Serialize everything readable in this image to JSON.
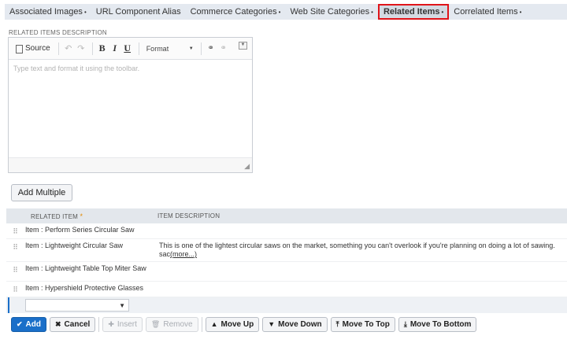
{
  "tabs": [
    {
      "label": "Associated Images",
      "caret": true,
      "active": false
    },
    {
      "label": "URL Component Alias",
      "caret": false,
      "active": false
    },
    {
      "label": "Commerce Categories",
      "caret": true,
      "active": false
    },
    {
      "label": "Web Site Categories",
      "caret": true,
      "active": false
    },
    {
      "label": "Related Items",
      "caret": true,
      "active": true
    },
    {
      "label": "Correlated Items",
      "caret": true,
      "active": false
    }
  ],
  "tab_caret": "•",
  "editor": {
    "section_label": "RELATED ITEMS DESCRIPTION",
    "source_label": "Source",
    "bold_label": "B",
    "italic_label": "I",
    "underline_label": "U",
    "format_label": "Format",
    "placeholder": "Type text and format it using the toolbar."
  },
  "add_multiple_label": "Add Multiple",
  "table": {
    "col_item": "RELATED ITEM",
    "col_item_required": "*",
    "col_desc": "ITEM DESCRIPTION",
    "rows": [
      {
        "item": "Item : Perform Series Circular Saw",
        "desc": "",
        "more": ""
      },
      {
        "item": "Item : Lightweight Circular Saw",
        "desc": "This is one of the lightest circular saws on the market, something you can't overlook if you're planning on doing a lot of sawing. sac",
        "more": "(more...)"
      },
      {
        "item": "Item : Lightweight Table Top Miter Saw",
        "desc": "",
        "more": ""
      },
      {
        "item": "Item : Hypershield Protective Glasses",
        "desc": "",
        "more": ""
      }
    ]
  },
  "actions": {
    "add": "Add",
    "cancel": "Cancel",
    "insert": "Insert",
    "remove": "Remove",
    "move_up": "Move Up",
    "move_down": "Move Down",
    "move_to_top": "Move To Top",
    "move_to_bottom": "Move To Bottom"
  },
  "colors": {
    "active_tab_border": "#e0141a",
    "primary_button": "#1a6fc9",
    "required_marker": "#e38a00"
  }
}
